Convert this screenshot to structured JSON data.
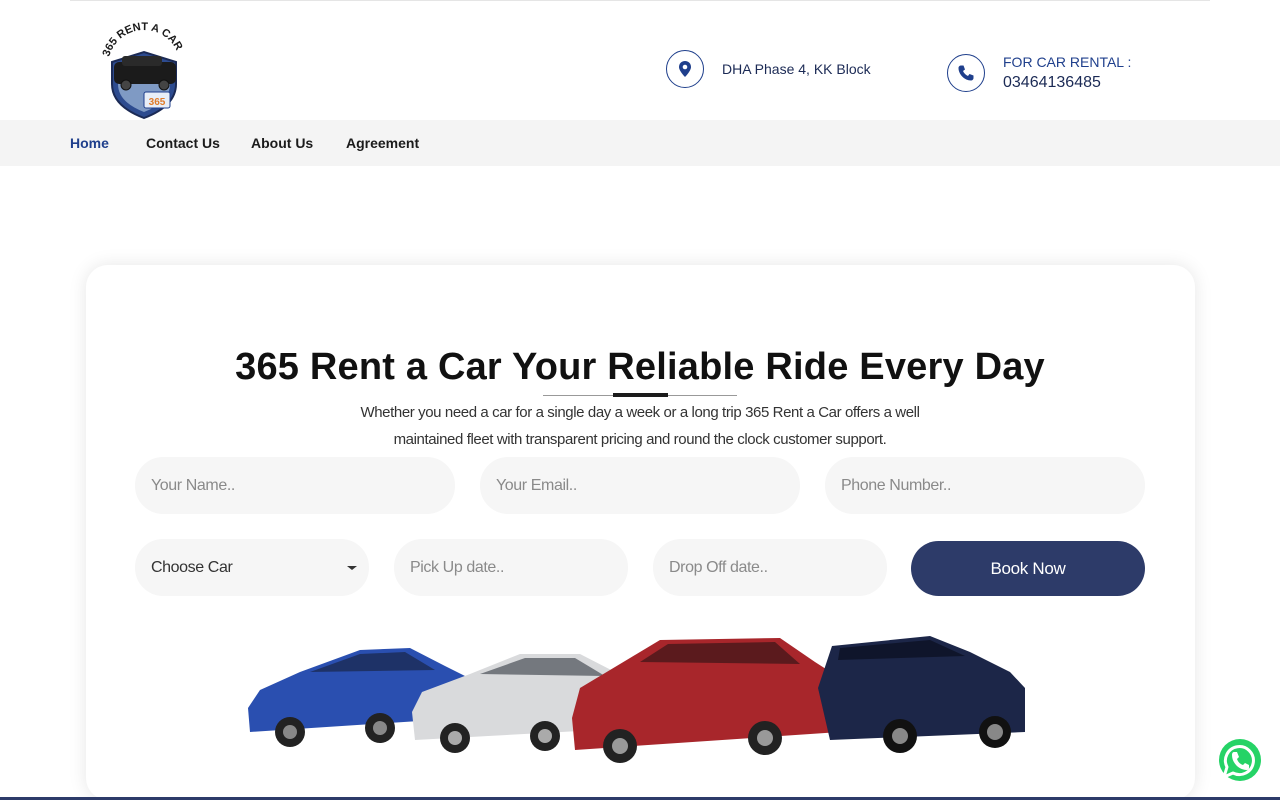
{
  "brand": {
    "logo_alt": "365 RENT A CAR"
  },
  "header": {
    "address": "DHA Phase 4, KK Block",
    "phone_label": "FOR CAR RENTAL :",
    "phone_number": "03464136485"
  },
  "nav": {
    "items": [
      {
        "label": "Home",
        "active": true
      },
      {
        "label": "Contact Us",
        "active": false
      },
      {
        "label": "About Us",
        "active": false
      },
      {
        "label": "Agreement",
        "active": false
      }
    ]
  },
  "hero": {
    "title": "365 Rent a Car Your Reliable Ride Every Day",
    "subtitle_line1": "Whether you need a car for a single day a week or a long trip 365 Rent a Car offers a well",
    "subtitle_line2": "maintained fleet with transparent pricing and round the clock customer support."
  },
  "form": {
    "name_placeholder": "Your Name..",
    "email_placeholder": "Your Email..",
    "phone_placeholder": "Phone Number..",
    "car_select_value": "Choose Car",
    "pickup_placeholder": "Pick Up date..",
    "dropoff_placeholder": "Drop Off date..",
    "submit_label": "Book Now"
  },
  "colors": {
    "brand_navy": "#2d3b69",
    "link_blue": "#1f3f8c",
    "whatsapp_green": "#25d366"
  }
}
